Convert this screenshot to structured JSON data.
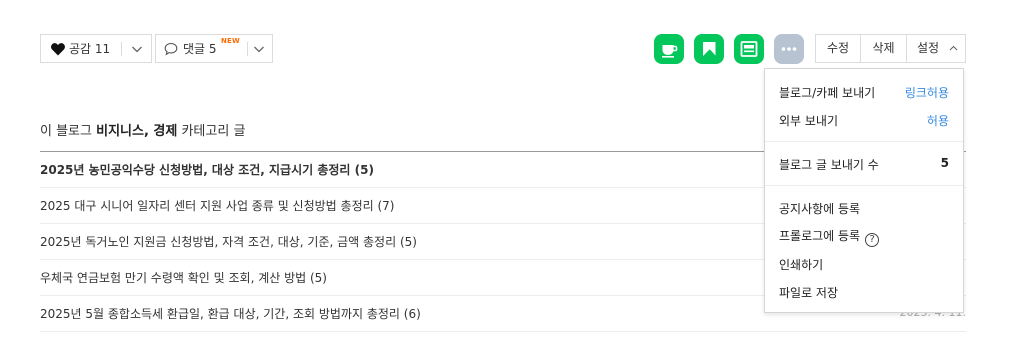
{
  "reactions": {
    "like_label": "공감 11",
    "comment_label": "댓글 5",
    "new_badge": "NEW"
  },
  "share_icons": [
    {
      "name": "cafe-icon",
      "color": "#03c75a"
    },
    {
      "name": "kakao-icon",
      "color": "#03c75a"
    },
    {
      "name": "news-icon",
      "color": "#03c75a"
    },
    {
      "name": "more-icon",
      "color": "#b7c3d1"
    }
  ],
  "toolbar": {
    "edit_label": "수정",
    "delete_label": "삭제",
    "settings_label": "설정"
  },
  "category": {
    "prefix": "이 블로그 ",
    "name": "비지니스, 경제",
    "suffix": " 카테고리 글"
  },
  "posts": [
    {
      "title": "2025년 농민공익수당 신청방법, 대상 조건, 지급시기 총정리 (5)",
      "date": ""
    },
    {
      "title": "2025 대구 시니어 일자리 센터 지원 사업 종류 및 신청방법 총정리 (7)",
      "date": ""
    },
    {
      "title": "2025년 독거노인 지원금 신청방법, 자격 조건, 대상, 기준, 금액 총정리 (5)",
      "date": ""
    },
    {
      "title": "우체국 연금보험 만기 수령액 확인 및 조회, 계산 방법 (5)",
      "date": ""
    },
    {
      "title": "2025년 5월 종합소득세 환급일, 환급 대상, 기간, 조회 방법까지 총정리 (6)",
      "date": "2025. 4. 11."
    }
  ],
  "menu": {
    "blog_cafe_share": {
      "label": "블로그/카페 보내기",
      "value": "링크허용"
    },
    "external_share": {
      "label": "외부 보내기",
      "value": "허용"
    },
    "share_count": {
      "label": "블로그 글 보내기 수",
      "value": "5"
    },
    "notice": {
      "label": "공지사항에 등록"
    },
    "prologue": {
      "label": "프롤로그에 등록",
      "help": "?"
    },
    "print": {
      "label": "인쇄하기"
    },
    "save_file": {
      "label": "파일로 저장"
    }
  }
}
